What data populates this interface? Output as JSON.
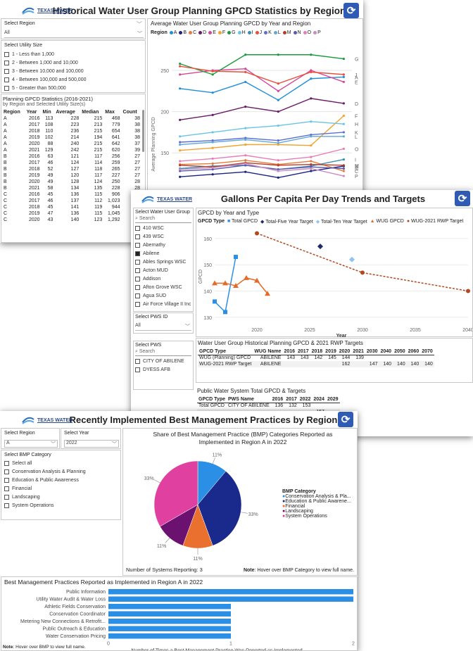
{
  "gpcd": {
    "logo_text": "TEXAS WATER",
    "title": "Historical Water User Group Planning GPCD Statistics by Region",
    "region_filter": {
      "label": "Select Region",
      "value": "All"
    },
    "size_filter": {
      "label": "Select Utility Size",
      "options": [
        "1 - Less than 1,000",
        "2 - Between 1,000 and 10,000",
        "3 - Between 10,000 and 100,000",
        "4 - Between 100,000 and 500,000",
        "5 - Greater than 500,000"
      ]
    },
    "stats": {
      "title": "Planning GPCD Statistics (2016-2021)",
      "subtitle": "by Region and Selected Utility Size(s)",
      "columns": [
        "Region",
        "Year",
        "Min",
        "Average",
        "Median",
        "Max",
        "Count"
      ],
      "rows": [
        [
          "A",
          "2016",
          "113",
          "228",
          "215",
          "468",
          "38"
        ],
        [
          "A",
          "2017",
          "108",
          "223",
          "213",
          "779",
          "38"
        ],
        [
          "A",
          "2018",
          "110",
          "236",
          "215",
          "654",
          "38"
        ],
        [
          "A",
          "2019",
          "102",
          "214",
          "194",
          "641",
          "38"
        ],
        [
          "A",
          "2020",
          "88",
          "240",
          "215",
          "642",
          "37"
        ],
        [
          "A",
          "2021",
          "129",
          "242",
          "215",
          "620",
          "39"
        ],
        [
          "B",
          "2016",
          "63",
          "121",
          "117",
          "256",
          "27"
        ],
        [
          "B",
          "2017",
          "46",
          "124",
          "114",
          "259",
          "27"
        ],
        [
          "B",
          "2018",
          "52",
          "127",
          "118",
          "265",
          "27"
        ],
        [
          "B",
          "2019",
          "49",
          "120",
          "117",
          "227",
          "27"
        ],
        [
          "B",
          "2020",
          "49",
          "128",
          "124",
          "250",
          "28"
        ],
        [
          "B",
          "2021",
          "58",
          "134",
          "135",
          "228",
          "28"
        ],
        [
          "C",
          "2016",
          "45",
          "136",
          "115",
          "906",
          "22"
        ],
        [
          "C",
          "2017",
          "46",
          "137",
          "112",
          "1,023",
          "22"
        ],
        [
          "C",
          "2018",
          "45",
          "141",
          "119",
          "944",
          "22"
        ],
        [
          "C",
          "2019",
          "47",
          "136",
          "115",
          "1,045",
          "22"
        ],
        [
          "C",
          "2020",
          "43",
          "140",
          "123",
          "1,292",
          "22"
        ]
      ]
    },
    "chart_data": {
      "type": "line",
      "title": "Average Water User Group Planning GPCD by Year and Region",
      "ylabel": "Average Planning GPCD",
      "legend_title": "Region",
      "x": [
        2016,
        2017,
        2018,
        2019,
        2020,
        2021
      ],
      "yticks": [
        100,
        150,
        200,
        250
      ],
      "ylim": [
        70,
        285
      ],
      "series": [
        {
          "name": "A",
          "color": "#1f8fd6",
          "values": [
            228,
            223,
            236,
            214,
            240,
            242
          ]
        },
        {
          "name": "B",
          "color": "#1a237e",
          "values": [
            121,
            124,
            127,
            120,
            128,
            134
          ]
        },
        {
          "name": "C",
          "color": "#e37b3a",
          "values": [
            136,
            137,
            141,
            136,
            140,
            128
          ]
        },
        {
          "name": "D",
          "color": "#6a1b6a",
          "values": [
            190,
            196,
            206,
            200,
            216,
            210
          ]
        },
        {
          "name": "E",
          "color": "#d4479a",
          "values": [
            245,
            250,
            252,
            225,
            250,
            236
          ]
        },
        {
          "name": "F",
          "color": "#f2a32c",
          "values": [
            153,
            156,
            160,
            160,
            159,
            195
          ]
        },
        {
          "name": "G",
          "color": "#1d9a3c",
          "values": [
            258,
            245,
            269,
            269,
            269,
            264
          ]
        },
        {
          "name": "H",
          "color": "#6ac4e3",
          "values": [
            170,
            175,
            180,
            183,
            188,
            185
          ]
        },
        {
          "name": "I",
          "color": "#3a8fb1",
          "values": [
            131,
            134,
            135,
            130,
            134,
            142
          ]
        },
        {
          "name": "J",
          "color": "#e8503b",
          "values": [
            255,
            249,
            248,
            234,
            248,
            245
          ]
        },
        {
          "name": "K",
          "color": "#5a6fd6",
          "values": [
            163,
            165,
            168,
            165,
            172,
            175
          ]
        },
        {
          "name": "L",
          "color": "#62a8d9",
          "values": [
            160,
            163,
            166,
            162,
            170,
            170
          ]
        },
        {
          "name": "M",
          "color": "#b83b26",
          "values": [
            135,
            133,
            138,
            135,
            136,
            135
          ]
        },
        {
          "name": "N",
          "color": "#5a57b1",
          "values": [
            128,
            130,
            135,
            130,
            133,
            131
          ]
        },
        {
          "name": "O",
          "color": "#e77db9",
          "values": [
            140,
            143,
            147,
            141,
            145,
            155
          ]
        },
        {
          "name": "P",
          "color": "#c88cc0",
          "values": [
            130,
            132,
            137,
            128,
            131,
            122
          ]
        }
      ]
    }
  },
  "trends": {
    "logo_text": "TEXAS WATER",
    "title": "Gallons Per Capita Per Day Trends and Targets",
    "wug_filter": {
      "label": "Select Water User Group",
      "search": "Search",
      "items": [
        {
          "name": "410 WSC",
          "checked": false
        },
        {
          "name": "439 WSC",
          "checked": false
        },
        {
          "name": "Abernathy",
          "checked": false
        },
        {
          "name": "Abilene",
          "checked": true
        },
        {
          "name": "Ables Springs WSC",
          "checked": false
        },
        {
          "name": "Acton MUD",
          "checked": false
        },
        {
          "name": "Addison",
          "checked": false
        },
        {
          "name": "Afton Grove WSC",
          "checked": false
        },
        {
          "name": "Agua SUD",
          "checked": false
        },
        {
          "name": "Air Force Village II Inc",
          "checked": false
        }
      ]
    },
    "pwsid_filter": {
      "label": "Select PWS ID",
      "value": "All"
    },
    "pws_filter": {
      "label": "Select PWS",
      "search": "Search",
      "items": [
        "CITY OF ABILENE",
        "DYESS AFB"
      ]
    },
    "chart_data": {
      "type": "line",
      "title": "GPCD by Year and Type",
      "legend_title": "GPCD Type",
      "xlabel": "Year",
      "ylabel": "GPCD",
      "xticks": [
        2020,
        2025,
        2030,
        2035,
        2040
      ],
      "yticks": [
        130,
        140,
        150,
        160
      ],
      "xlim": [
        2016,
        2040
      ],
      "ylim": [
        127,
        164
      ],
      "series": [
        {
          "name": "Total GPCD",
          "color": "#2b8fe6",
          "marker": "square",
          "points": [
            [
              2016,
              136
            ],
            [
              2017,
              132
            ],
            [
              2018,
              153
            ]
          ]
        },
        {
          "name": "Total-Five Year Target",
          "color": "#1f2a6b",
          "marker": "diamond",
          "points": [
            [
              2026,
              157
            ]
          ]
        },
        {
          "name": "Total-Ten Year Target",
          "color": "#8ec5f2",
          "marker": "diamond",
          "points": [
            [
              2029,
              152
            ]
          ]
        },
        {
          "name": "WUG GPCD",
          "color": "#e36c2b",
          "marker": "triangle",
          "points": [
            [
              2016,
              143
            ],
            [
              2017,
              143
            ],
            [
              2018,
              142
            ],
            [
              2019,
              145
            ],
            [
              2020,
              144
            ],
            [
              2021,
              139
            ]
          ]
        },
        {
          "name": "WUG-2021 RWP Target",
          "color": "#b3471f",
          "marker": "circle",
          "dashed": true,
          "points": [
            [
              2020,
              162
            ],
            [
              2030,
              147
            ],
            [
              2040,
              140
            ]
          ]
        }
      ]
    },
    "wug_table": {
      "title": "Water User Group Historical Planning GPCD & 2021 RWP Targets",
      "columns": [
        "GPCD Type",
        "WUG Name",
        "2016",
        "2017",
        "2018",
        "2019",
        "2020",
        "2021",
        "2030",
        "2040",
        "2050",
        "2060",
        "2070"
      ],
      "rows": [
        [
          "WUG (Planning) GPCD",
          "ABILENE",
          "143",
          "143",
          "142",
          "145",
          "144",
          "139",
          "",
          "",
          "",
          "",
          ""
        ],
        [
          "WUG-2021 RWP Target",
          "ABILENE",
          "",
          "",
          "",
          "",
          "162",
          "",
          "147",
          "140",
          "140",
          "140",
          "140"
        ]
      ]
    },
    "pws_table": {
      "title": "Public Water System Total GPCD & Targets",
      "columns": [
        "GPCD Type",
        "PWS Name",
        "2016",
        "2017",
        "2022",
        "2024",
        "2029"
      ],
      "rows": [
        [
          "Total GPCD",
          "CITY OF ABILENE",
          "136",
          "132",
          "153",
          "",
          ""
        ],
        [
          "",
          "",
          "",
          "",
          "",
          "157",
          ""
        ],
        [
          "",
          "",
          "",
          "",
          "",
          "",
          "152"
        ]
      ]
    }
  },
  "bmp": {
    "logo_text": "TEXAS WATER",
    "title": "Recently Implemented Best Management Practices by Region",
    "region_filter": {
      "label": "Select Region",
      "value": "A"
    },
    "year_filter": {
      "label": "Select Year",
      "value": "2022"
    },
    "category_filter": {
      "label": "Select BMP Category",
      "items": [
        "Select all",
        "Conservation Analysis & Planning",
        "Education & Public Awareness",
        "Financial",
        "Landscaping",
        "System Operations"
      ]
    },
    "pie": {
      "chart_data": {
        "type": "pie",
        "title": "Share of Best Management Practice (BMP) Categories Reported as Implemented in Region A in 2022",
        "legend_title": "BMP Category",
        "slices": [
          {
            "name": "Conservation Analysis & Pla...",
            "value": 11,
            "color": "#2b8fe6",
            "label": "11%"
          },
          {
            "name": "Education & Public Awarene...",
            "value": 33,
            "color": "#1a2a8c",
            "label": "33%"
          },
          {
            "name": "Financial",
            "value": 11,
            "color": "#e9702f",
            "label": "11%"
          },
          {
            "name": "Landscaping",
            "value": 11,
            "color": "#6b1170",
            "label": "11%"
          },
          {
            "name": "System Operations",
            "value": 33,
            "color": "#e0409f",
            "label": "33%"
          }
        ]
      },
      "footer_left": "Number of Systems Reporting: 3",
      "note_bold": "Note",
      "note_text": ": Hover over BMP Category to view full name."
    },
    "bars": {
      "chart_data": {
        "type": "bar",
        "orientation": "horizontal",
        "title": "Best Management Practices Reported as Implemented in Region A in 2022",
        "xlabel": "Number of Times a Best Management Practice Was Reported as Implemented",
        "xticks": [
          0,
          1,
          2
        ],
        "xlim": [
          0,
          2
        ],
        "color": "#2b8fe6",
        "categories": [
          "Public Information",
          "Utility Water Audit & Water Loss",
          "Athletic Fields Conservation",
          "Conservation Coordinator",
          "Metering New Connections & Retrofit...",
          "Public Outreach & Education",
          "Water Conservation Pricing"
        ],
        "values": [
          2,
          2,
          1,
          1,
          1,
          1,
          1
        ]
      },
      "note_bold": "Note",
      "note_text": ": Hover over BMP to view full name."
    }
  }
}
